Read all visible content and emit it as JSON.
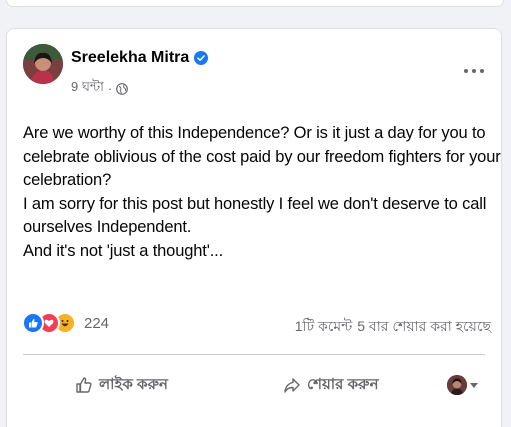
{
  "post": {
    "author": "Sreelekha Mitra",
    "timestamp": "9 ঘন্টা",
    "separator": "·",
    "text_lines": [
      "Are we worthy of this Independence? Or is it just a day for you to",
      "celebrate oblivious of the cost paid by our freedom fighters for your",
      "celebration?",
      "I am sorry for this post but honestly I feel we don't deserve to call",
      "ourselves Independent.",
      "And it's not 'just a thought'..."
    ]
  },
  "engagement": {
    "reaction_count": "224",
    "comments": "1টি কমেন্ট",
    "shares": "5 বার শেয়ার করা হয়েছে"
  },
  "actions": {
    "like_label": "লাইক করুন",
    "share_label": "শেয়ার করুন"
  },
  "icons": {
    "verified": "verified-badge-icon",
    "audience": "globe-icon",
    "more": "more-options-icon",
    "like": "thumbs-up-icon",
    "share": "share-arrow-icon"
  },
  "colors": {
    "brand_blue": "#1877f2",
    "love_red": "#f33e58",
    "haha_yellow": "#f7b125",
    "secondary_text": "#65676b"
  }
}
